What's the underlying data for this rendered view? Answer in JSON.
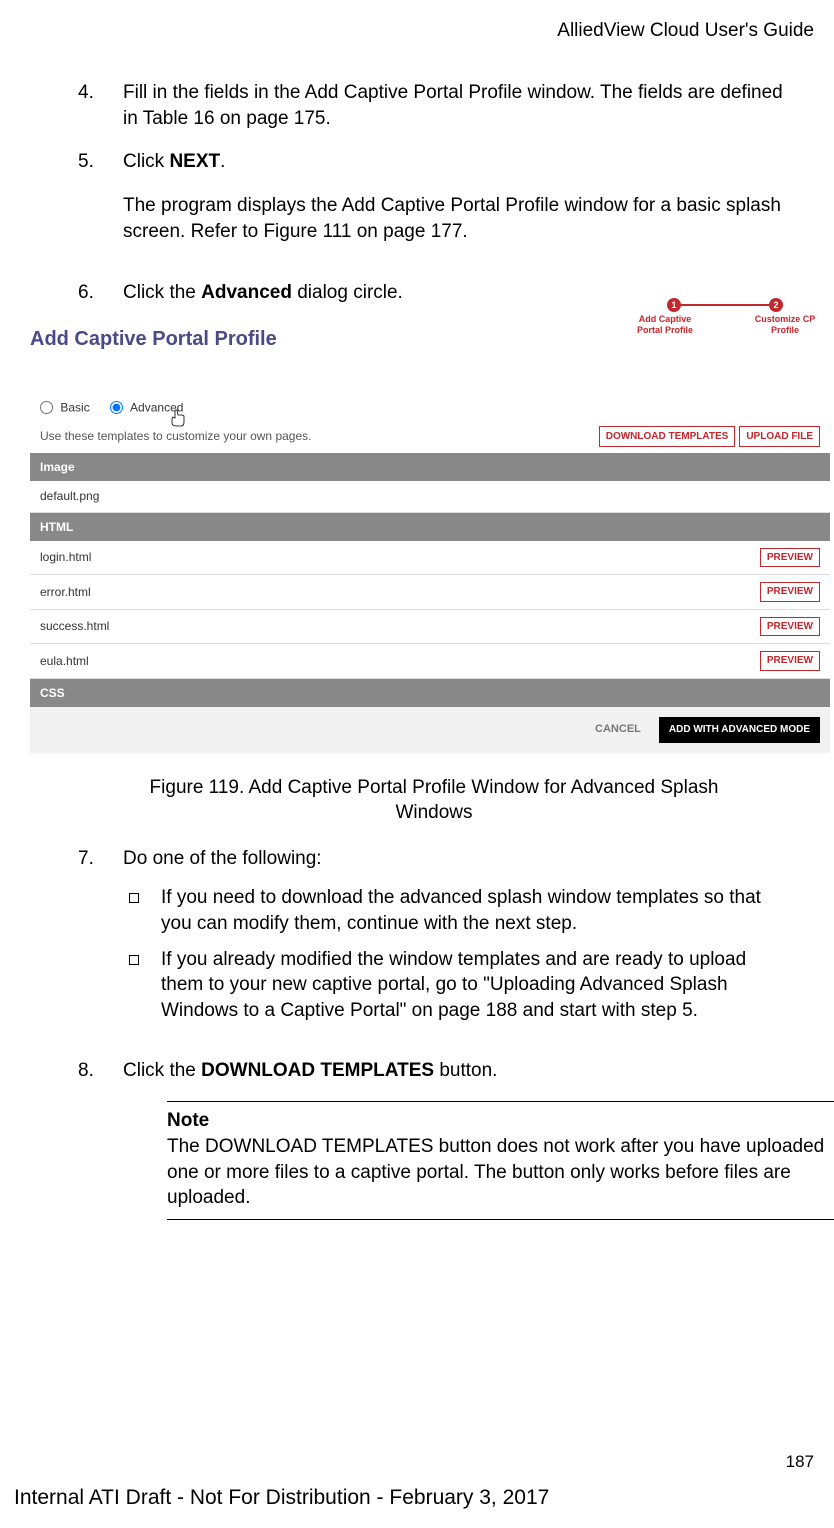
{
  "header": {
    "guide_title": "AlliedView Cloud User's Guide"
  },
  "steps": {
    "s4": {
      "num": "4.",
      "text": "Fill in the fields in the Add Captive Portal Profile window. The fields are defined in Table 16 on page 175."
    },
    "s5": {
      "num": "5.",
      "text_a": "Click ",
      "bold": "NEXT",
      "text_b": ".",
      "para2": "The program displays the Add Captive Portal Profile window for a basic splash screen. Refer to Figure 111 on page 177."
    },
    "s6": {
      "num": "6.",
      "text_a": "Click the ",
      "bold": "Advanced",
      "text_b": " dialog circle."
    },
    "s7": {
      "num": "7.",
      "text": "Do one of the following:"
    },
    "s8": {
      "num": "8.",
      "text_a": "Click the ",
      "bold": "DOWNLOAD TEMPLATES",
      "text_b": " button."
    }
  },
  "bullets": {
    "b1": "If you need to download the advanced splash window templates so that you can modify them, continue with the next step.",
    "b2": "If you already modified the window templates and are ready to upload them to your new captive portal, go to \"Uploading Advanced Splash Windows to a Captive Portal\" on page 188 and start with step 5."
  },
  "note": {
    "heading": "Note",
    "body": "The DOWNLOAD TEMPLATES button does not work after you have uploaded one or more files to a captive portal. The button only works before files are uploaded."
  },
  "figure_caption": "Figure 119. Add Captive Portal Profile Window for Advanced Splash Windows",
  "screenshot": {
    "title": "Add Captive Portal Profile",
    "stepper": {
      "n1": "1",
      "n2": "2",
      "label1": "Add Captive Portal Profile",
      "label2": "Customize CP Profile"
    },
    "radio_basic": "Basic",
    "radio_advanced": "Advanced",
    "hint": "Use these templates to customize your own pages.",
    "download_btn": "DOWNLOAD TEMPLATES",
    "upload_btn": "UPLOAD FILE",
    "section_image": "Image",
    "file_image": "default.png",
    "section_html": "HTML",
    "html_files": [
      "login.html",
      "error.html",
      "success.html",
      "eula.html"
    ],
    "preview": "PREVIEW",
    "section_css": "CSS",
    "cancel": "CANCEL",
    "add_advanced": "ADD WITH ADVANCED MODE"
  },
  "page_number": "187",
  "footer_draft": "Internal ATI Draft - Not For Distribution - February 3, 2017"
}
